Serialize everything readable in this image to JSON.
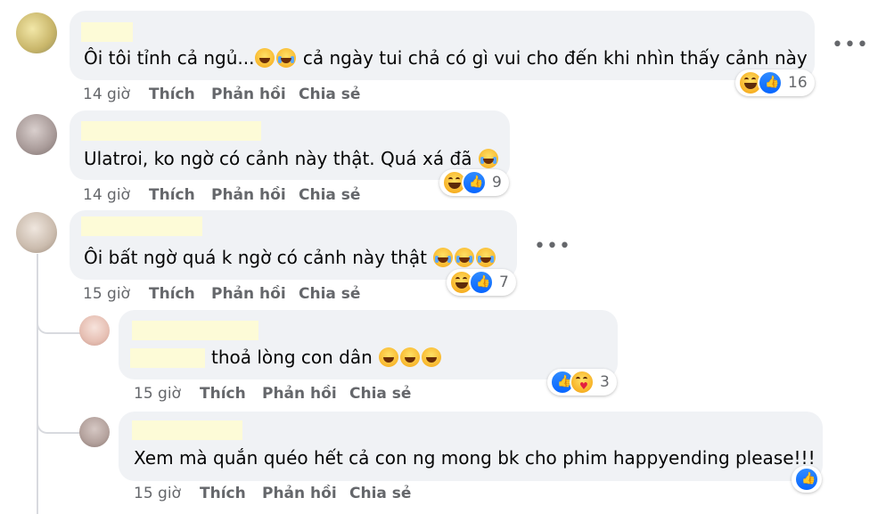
{
  "colors": {
    "bubble": "#f0f2f5",
    "meta": "#65676b",
    "like_blue": "#0866ff",
    "name_mask": "#fdfbd7"
  },
  "comments": [
    {
      "text_before": "Ôi tôi tỉnh cả ngủ...",
      "emojis_mid": [
        "haha-icon",
        "rofl-icon"
      ],
      "text_after": " cả ngày tui chả có gì vui cho đến khi nhìn thấy cảnh này",
      "time": "14 giờ",
      "like": "Thích",
      "reply": "Phản hồi",
      "share": "Chia sẻ",
      "reactions": [
        "haha",
        "like"
      ],
      "reaction_count": "16"
    },
    {
      "text_before": "Ulatroi, ko ngờ có cảnh này thật. Quá xá đã",
      "emojis_end": [
        "rofl-icon"
      ],
      "time": "14 giờ",
      "like": "Thích",
      "reply": "Phản hồi",
      "share": "Chia sẻ",
      "reactions": [
        "haha",
        "like"
      ],
      "reaction_count": "9"
    },
    {
      "text_before": "Ôi bất ngờ quá k ngờ có cảnh này thật",
      "emojis_end": [
        "crying-laugh-icon",
        "crying-laugh-icon",
        "crying-laugh-icon"
      ],
      "time": "15 giờ",
      "like": "Thích",
      "reply": "Phản hồi",
      "share": "Chia sẻ",
      "reactions": [
        "haha",
        "like"
      ],
      "reaction_count": "7"
    },
    {
      "text_before": "thoả lòng con dân",
      "emojis_end": [
        "haha-icon",
        "haha-icon",
        "haha-icon"
      ],
      "time": "15 giờ",
      "like": "Thích",
      "reply": "Phản hồi",
      "share": "Chia sẻ",
      "reactions": [
        "like",
        "care"
      ],
      "reaction_count": "3"
    },
    {
      "text_before": "Xem mà quắn quéo hết cả con ng mong bk cho phim happyending please!!!",
      "time": "15 giờ",
      "like": "Thích",
      "reply": "Phản hồi",
      "share": "Chia sẻ",
      "reactions": [
        "like"
      ],
      "reaction_count": ""
    }
  ],
  "more_label": "•••"
}
